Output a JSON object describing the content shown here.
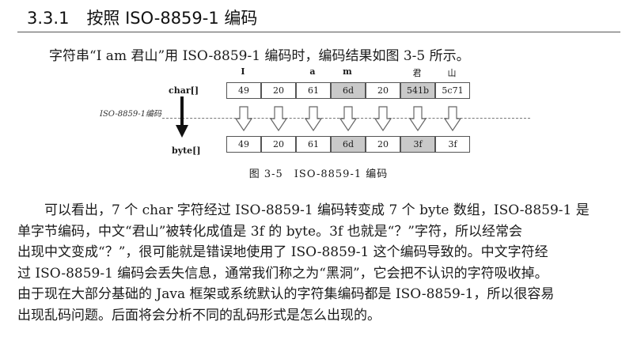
{
  "section": {
    "number": "3.3.1",
    "title": "按照 ISO-8859-1 编码"
  },
  "intro": "字符串“I am 君山”用 ISO-8859-1 编码时，编码结果如图 3-5 所示。",
  "figure": {
    "chars": [
      "I",
      "",
      "a",
      "m",
      "",
      "君",
      "山"
    ],
    "row1_label": "char[]",
    "row2_label": "byte[]",
    "encoding_label": "ISO-8859-1编码",
    "char_values": [
      "49",
      "20",
      "61",
      "6d",
      "20",
      "541b",
      "5c71"
    ],
    "byte_values": [
      "49",
      "20",
      "61",
      "6d",
      "20",
      "3f",
      "3f"
    ],
    "caption": "图 3-5　ISO-8859-1 编码"
  },
  "paragraph": [
    "可以看出，7 个 char 字符经过 ISO-8859-1 编码转变成 7 个 byte 数组，ISO-8859-1 是",
    "单字节编码，中文“君山”被转化成值是 3f 的 byte。3f 也就是“？”字符，所以经常会",
    "出现中文变成“？”，很可能就是错误地使用了 ISO-8859-1 这个编码导致的。中文字符经",
    "过 ISO-8859-1 编码会丢失信息，通常我们称之为“黑洞”，它会把不认识的字符吸收掉。",
    "由于现在大部分基础的 Java 框架或系统默认的字符集编码都是 ISO-8859-1，所以很容易",
    "出现乱码问题。后面将会分析不同的乱码形式是怎么出现的。"
  ]
}
